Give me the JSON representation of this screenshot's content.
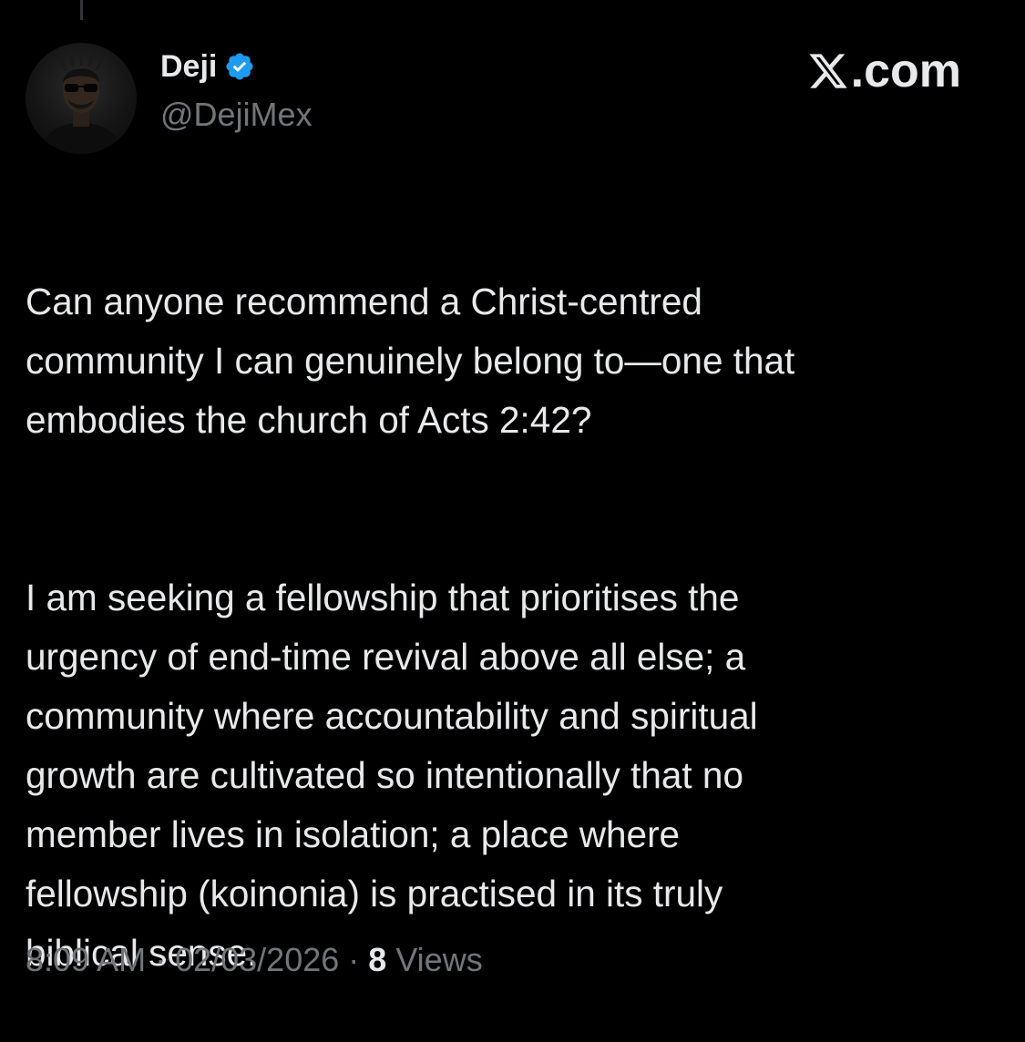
{
  "author": {
    "display_name": "Deji",
    "handle": "@DejiMex",
    "verified": true,
    "verified_color": "#1d9bf0",
    "avatar_icon": "profile-photo"
  },
  "brand": {
    "label": ".com",
    "icon": "x-logo-icon"
  },
  "tweet": {
    "paragraphs": [
      "Can anyone recommend a Christ-centred\ncommunity I can genuinely belong to—one that\nembodies the church of Acts 2:42?",
      "I am seeking a fellowship that prioritises the\nurgency of end-time revival above all else; a\ncommunity where accountability and spiritual\ngrowth are cultivated so intentionally that no\nmember lives in isolation; a place where\nfellowship (koinonia) is practised in its truly\nbiblical sense."
    ]
  },
  "meta": {
    "time": "8:09 AM",
    "separator": " · ",
    "date": "02/03/2026",
    "views_count": "8",
    "views_label": " Views"
  },
  "colors": {
    "background": "#000000",
    "primary_text": "#e7e9ea",
    "secondary_text": "#71767b"
  }
}
